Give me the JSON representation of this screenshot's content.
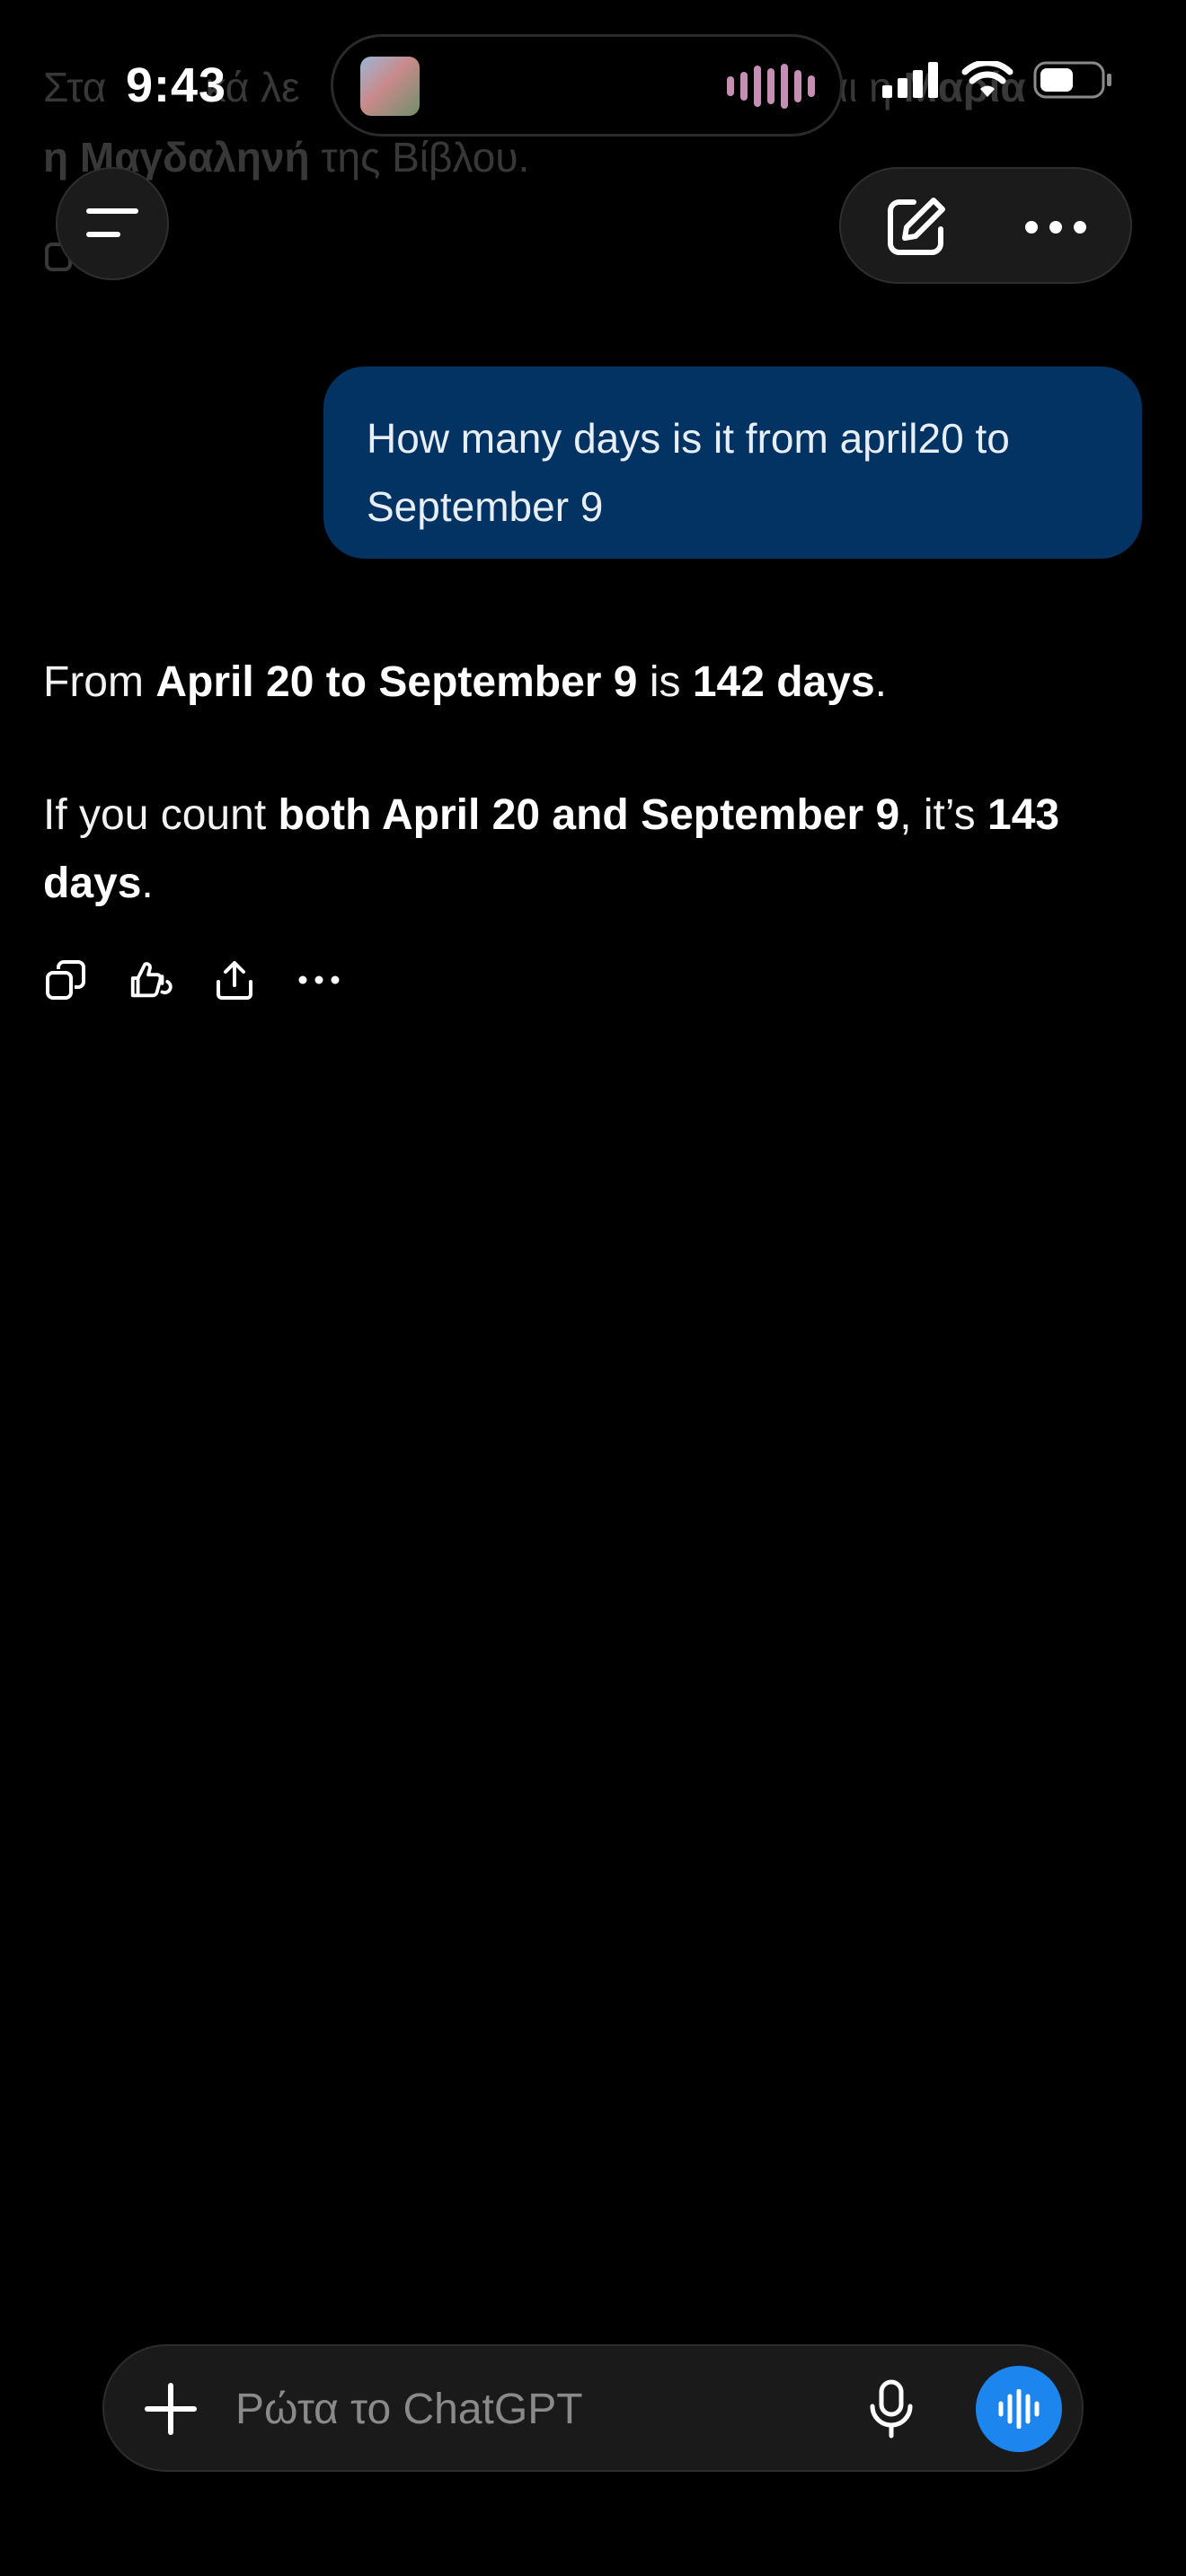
{
  "status_bar": {
    "time": "9:43"
  },
  "previous_message": {
    "line1_part1": "Στα",
    "line1_part2": "κά λε",
    "line1_part3": "Είναι η",
    "line1_part4": "Μαρία",
    "line2_bold": "η Μαγδαληνή",
    "line2_rest": " της Βίβλου."
  },
  "user_message": {
    "text": "How many days is it from april20 to September 9"
  },
  "assistant_reply": {
    "p1": {
      "t1": "From ",
      "b1": "April 20 to September 9",
      "t2": " is ",
      "b2": "142 days",
      "t3": "."
    },
    "p2": {
      "t1": "If you count ",
      "b1": "both April 20 and September 9",
      "t2": ", it’s ",
      "b2": "143 days",
      "t3": "."
    }
  },
  "composer": {
    "placeholder": "Ρώτα το ChatGPT"
  },
  "colors": {
    "user_bubble": "#033363",
    "voice_button": "#1c86ee",
    "background": "#000000"
  },
  "icons": {
    "header": [
      "menu-icon",
      "edit-icon",
      "more-icon"
    ],
    "reply_actions": [
      "copy-icon",
      "thumbs-icon",
      "share-icon",
      "more-icon"
    ],
    "composer": [
      "plus-icon",
      "mic-icon",
      "voice-wave-icon"
    ]
  }
}
